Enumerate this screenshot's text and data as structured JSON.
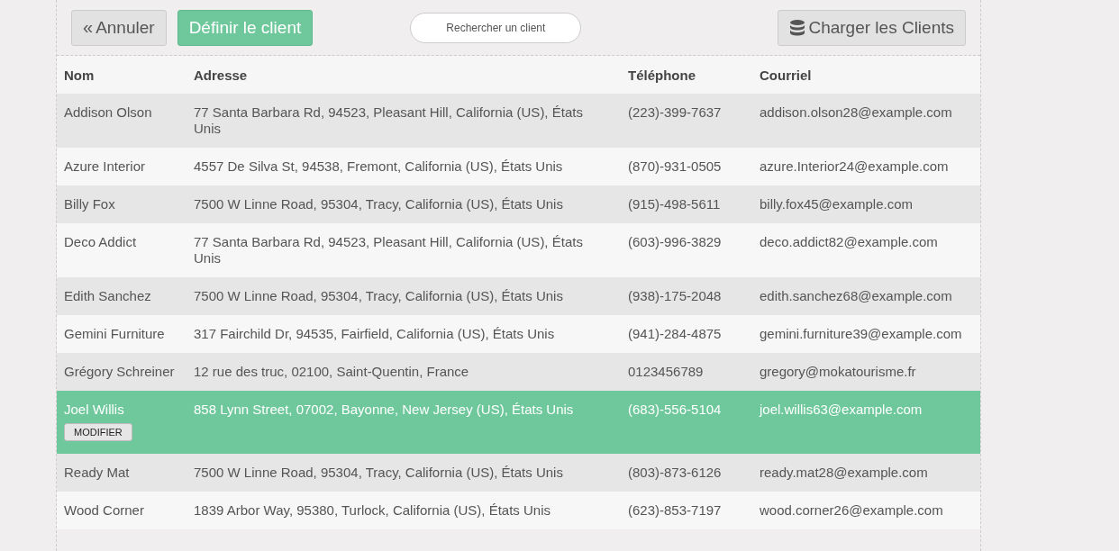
{
  "toolbar": {
    "cancel_button": {
      "icon": "«",
      "label": "Annuler"
    },
    "set_button": "Définir le client",
    "search": {
      "placeholder": "Rechercher un client"
    },
    "load_button": "Charger les Clients"
  },
  "table": {
    "columns": [
      "Nom",
      "Adresse",
      "Téléphone",
      "Courriel"
    ],
    "rows": [
      {
        "name": "Addison Olson",
        "address": "77 Santa Barbara Rd, 94523, Pleasant Hill, California (US), États Unis",
        "phone": "(223)-399-7637",
        "email": "addison.olson28@example.com",
        "selected": false
      },
      {
        "name": "Azure Interior",
        "address": "4557 De Silva St, 94538, Fremont, California (US), États Unis",
        "phone": "(870)-931-0505",
        "email": "azure.Interior24@example.com",
        "selected": false
      },
      {
        "name": "Billy Fox",
        "address": "7500 W Linne Road, 95304, Tracy, California (US), États Unis",
        "phone": "(915)-498-5611",
        "email": "billy.fox45@example.com",
        "selected": false
      },
      {
        "name": "Deco Addict",
        "address": "77 Santa Barbara Rd, 94523, Pleasant Hill, California (US), États Unis",
        "phone": "(603)-996-3829",
        "email": "deco.addict82@example.com",
        "selected": false
      },
      {
        "name": "Edith Sanchez",
        "address": "7500 W Linne Road, 95304, Tracy, California (US), États Unis",
        "phone": "(938)-175-2048",
        "email": "edith.sanchez68@example.com",
        "selected": false
      },
      {
        "name": "Gemini Furniture",
        "address": "317 Fairchild Dr, 94535, Fairfield, California (US), États Unis",
        "phone": "(941)-284-4875",
        "email": "gemini.furniture39@example.com",
        "selected": false
      },
      {
        "name": "Grégory Schreiner",
        "address": "12 rue des truc, 02100, Saint-Quentin, France",
        "phone": "0123456789",
        "email": "gregory@mokatourisme.fr",
        "selected": false
      },
      {
        "name": "Joel Willis",
        "address": "858 Lynn Street, 07002, Bayonne, New Jersey (US), États Unis",
        "phone": "(683)-556-5104",
        "email": "joel.willis63@example.com",
        "selected": true,
        "edit_button": "MODIFIER"
      },
      {
        "name": "Ready Mat",
        "address": "7500 W Linne Road, 95304, Tracy, California (US), États Unis",
        "phone": "(803)-873-6126",
        "email": "ready.mat28@example.com",
        "selected": false
      },
      {
        "name": "Wood Corner",
        "address": "1839 Arbor Way, 95380, Turlock, California (US), États Unis",
        "phone": "(623)-853-7197",
        "email": "wood.corner26@example.com",
        "selected": false
      }
    ]
  }
}
